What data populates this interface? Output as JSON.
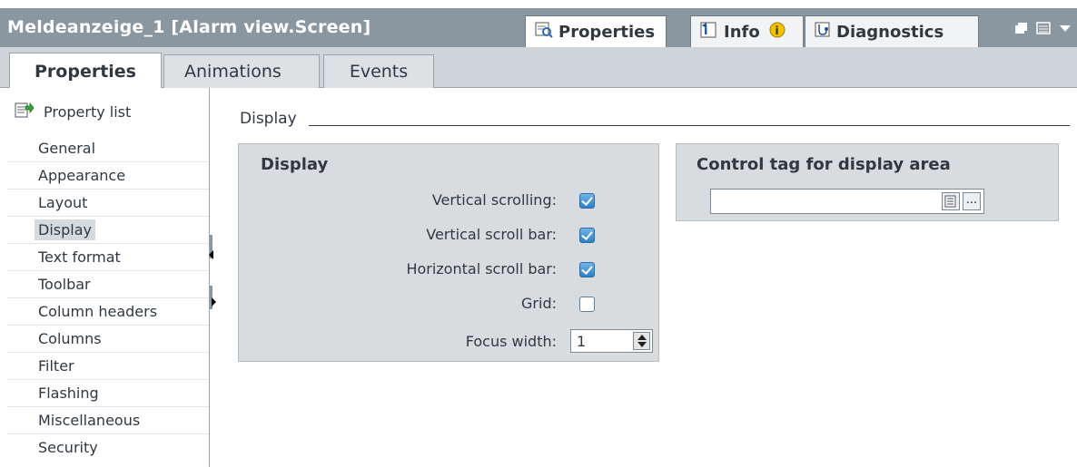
{
  "window": {
    "title": "Meldeanzeige_1 [Alarm view.Screen]",
    "tabs": [
      {
        "label": "Properties",
        "icon": "properties-icon",
        "active": true
      },
      {
        "label": "Info",
        "icon": "info-icon",
        "badge_icon": "info-badge-icon",
        "active": false
      },
      {
        "label": "Diagnostics",
        "icon": "diagnostics-icon",
        "active": false
      }
    ],
    "controls": [
      "restore-icon",
      "menu-icon",
      "chevron-down-icon"
    ]
  },
  "subtabs": [
    {
      "label": "Properties",
      "active": true
    },
    {
      "label": "Animations",
      "active": false
    },
    {
      "label": "Events",
      "active": false
    }
  ],
  "sidebar": {
    "header": "Property list",
    "items": [
      {
        "label": "General"
      },
      {
        "label": "Appearance"
      },
      {
        "label": "Layout"
      },
      {
        "label": "Display",
        "selected": true
      },
      {
        "label": "Text format"
      },
      {
        "label": "Toolbar"
      },
      {
        "label": "Column headers"
      },
      {
        "label": "Columns"
      },
      {
        "label": "Filter"
      },
      {
        "label": "Flashing"
      },
      {
        "label": "Miscellaneous"
      },
      {
        "label": "Security"
      }
    ]
  },
  "main": {
    "section_title": "Display",
    "display_panel": {
      "title": "Display",
      "rows": [
        {
          "label": "Vertical scrolling:",
          "checked": true
        },
        {
          "label": "Vertical scroll bar:",
          "checked": true
        },
        {
          "label": "Horizontal scroll bar:",
          "checked": true
        },
        {
          "label": "Grid:",
          "checked": false
        }
      ],
      "focus_width_label": "Focus width:",
      "focus_width_value": "1"
    },
    "control_tag_panel": {
      "title": "Control tag for display area",
      "value": "",
      "browse_label": "..."
    }
  },
  "colors": {
    "titlebar": "#8a96a0",
    "checkbox_on": "#2f7fc4",
    "panel_bg": "#d9dcdf"
  }
}
